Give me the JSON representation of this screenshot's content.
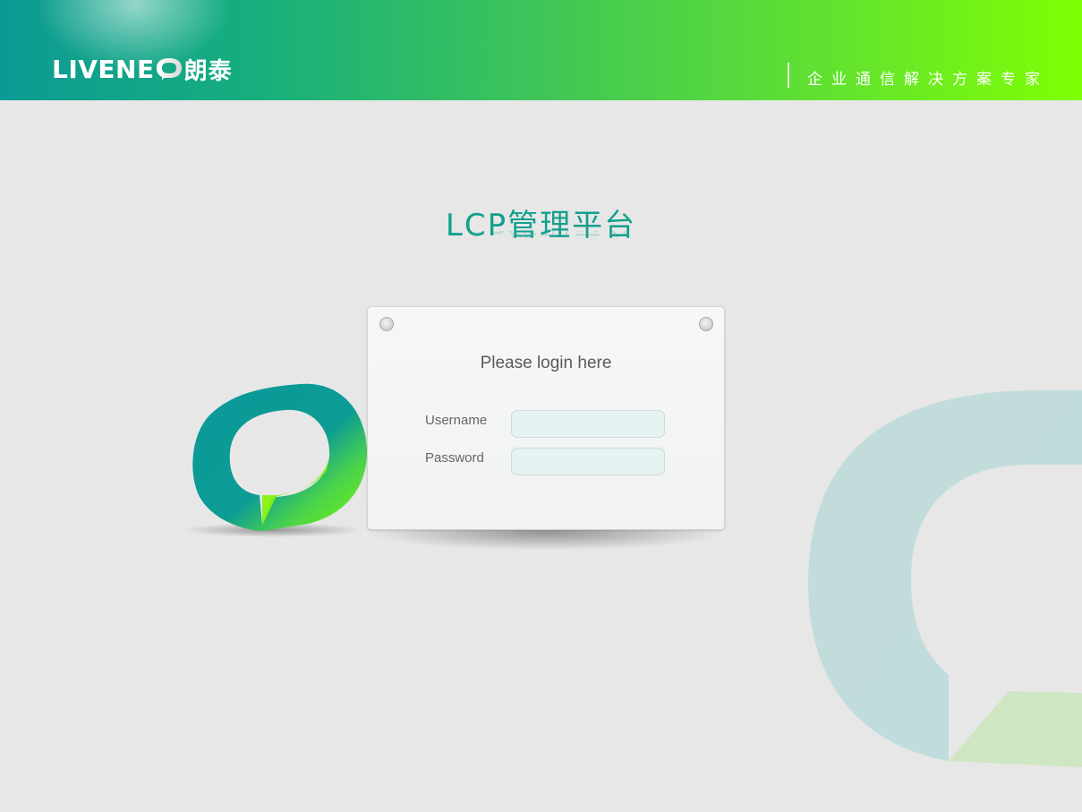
{
  "header": {
    "brand_text": "LIVENE",
    "brand_cn": "朗泰",
    "slogan": "企业通信解决方案专家",
    "gradient_colors": [
      "#0d9a94",
      "#15ad7f",
      "#3fc558",
      "#66e62a",
      "#7eff04"
    ]
  },
  "title": "LCP管理平台",
  "login": {
    "heading": "Please login here",
    "username_label": "Username",
    "password_label": "Password",
    "username_value": "",
    "password_value": ""
  },
  "colors": {
    "accent": "#12a08e",
    "background": "#e7e7e7",
    "input_bg": "#e7f2f2"
  },
  "icons": [
    "speech-bubble-logo-icon",
    "pin-icon"
  ]
}
